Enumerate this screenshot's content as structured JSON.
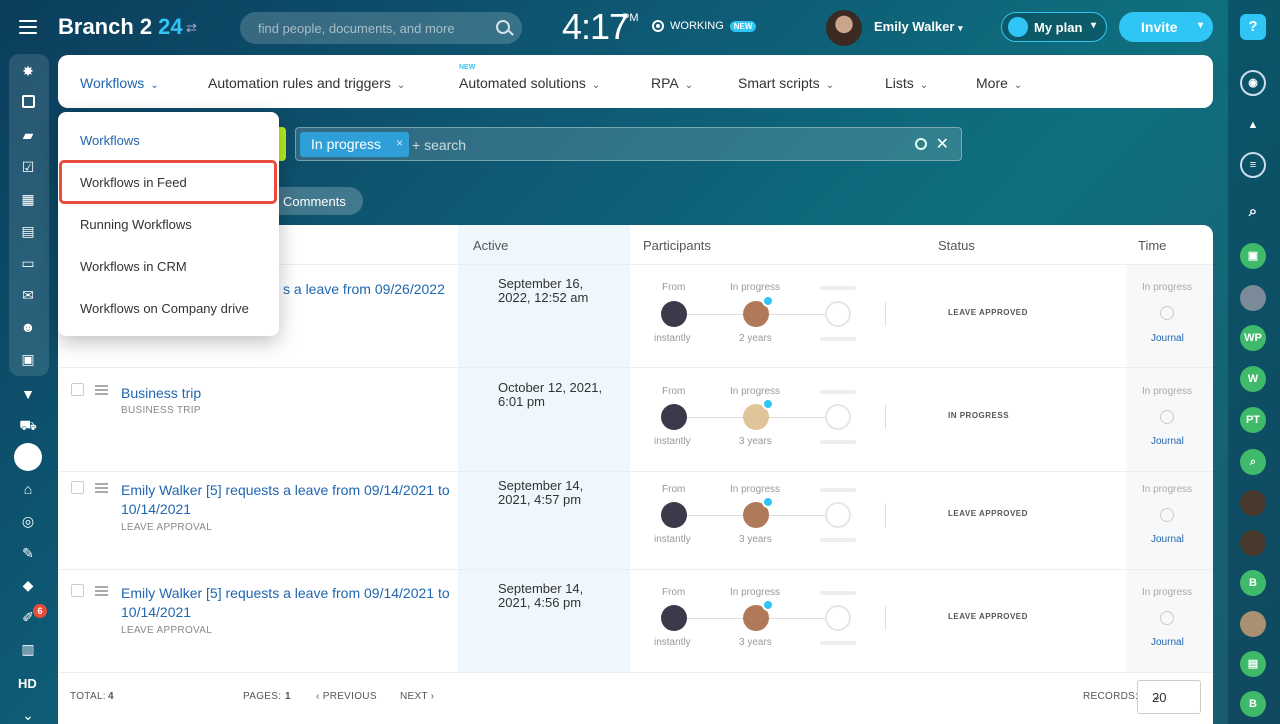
{
  "header": {
    "logo_text": "Branch 2",
    "logo_number": "24",
    "search_placeholder": "find people, documents, and more",
    "clock_time": "4:17",
    "clock_ampm": "PM",
    "working_label": "WORKING",
    "working_badge": "NEW",
    "user_name": "Emily Walker",
    "plan_label": "My plan",
    "invite_label": "Invite"
  },
  "right_bar": {
    "help_label": "?",
    "items": [
      "WP",
      "W",
      "PT",
      "B",
      "B"
    ]
  },
  "left_bar": {
    "notification_count": "6",
    "hd_label": "HD"
  },
  "nav": {
    "tabs": [
      {
        "label": "Workflows"
      },
      {
        "label": "Automation rules and triggers"
      },
      {
        "label": "Automated solutions",
        "badge": "NEW"
      },
      {
        "label": "RPA"
      },
      {
        "label": "Smart scripts"
      },
      {
        "label": "Lists"
      },
      {
        "label": "More"
      }
    ]
  },
  "dropdown": {
    "items": [
      "Workflows",
      "Workflows in Feed",
      "Running Workflows",
      "Workflows in CRM",
      "Workflows on Company drive"
    ]
  },
  "filter": {
    "chip_label": "In progress",
    "chip_close": "×",
    "search_placeholder": "+ search",
    "comments_label": "Comments"
  },
  "table": {
    "headers": {
      "active": "Active",
      "participants": "Participants",
      "status": "Status",
      "time": "Time"
    },
    "rows": [
      {
        "title": "s a leave from 09/26/2022",
        "subtitle": "",
        "active": "September 16, 2022, 12:52 am",
        "from_label": "From",
        "progress_label": "In progress",
        "from_time": "instantly",
        "progress_time": "2 years",
        "status": "LEAVE APPROVED",
        "time_label": "In progress",
        "journal": "Journal"
      },
      {
        "title": "Business trip",
        "subtitle": "BUSINESS TRIP",
        "active": "October 12, 2021, 6:01 pm",
        "from_label": "From",
        "progress_label": "In progress",
        "from_time": "instantly",
        "progress_time": "3 years",
        "status": "IN PROGRESS",
        "time_label": "In progress",
        "journal": "Journal"
      },
      {
        "title": "Emily Walker [5] requests a leave from 09/14/2021 to 10/14/2021",
        "subtitle": "LEAVE APPROVAL",
        "active": "September 14, 2021, 4:57 pm",
        "from_label": "From",
        "progress_label": "In progress",
        "from_time": "instantly",
        "progress_time": "3 years",
        "status": "LEAVE APPROVED",
        "time_label": "In progress",
        "journal": "Journal"
      },
      {
        "title": "Emily Walker [5] requests a leave from 09/14/2021 to 10/14/2021",
        "subtitle": "LEAVE APPROVAL",
        "active": "September 14, 2021, 4:56 pm",
        "from_label": "From",
        "progress_label": "In progress",
        "from_time": "instantly",
        "progress_time": "3 years",
        "status": "LEAVE APPROVED",
        "time_label": "In progress",
        "journal": "Journal"
      }
    ]
  },
  "footer": {
    "total_label": "TOTAL:",
    "total_value": "4",
    "pages_label": "PAGES:",
    "pages_value": "1",
    "previous": "PREVIOUS",
    "next": "NEXT",
    "records_label": "RECORDS:",
    "records_value": "20"
  },
  "colors": {
    "accent": "#2fc6f6",
    "link": "#2066b0",
    "highlight": "#e74c3c",
    "filter_green": "#bbed21"
  }
}
